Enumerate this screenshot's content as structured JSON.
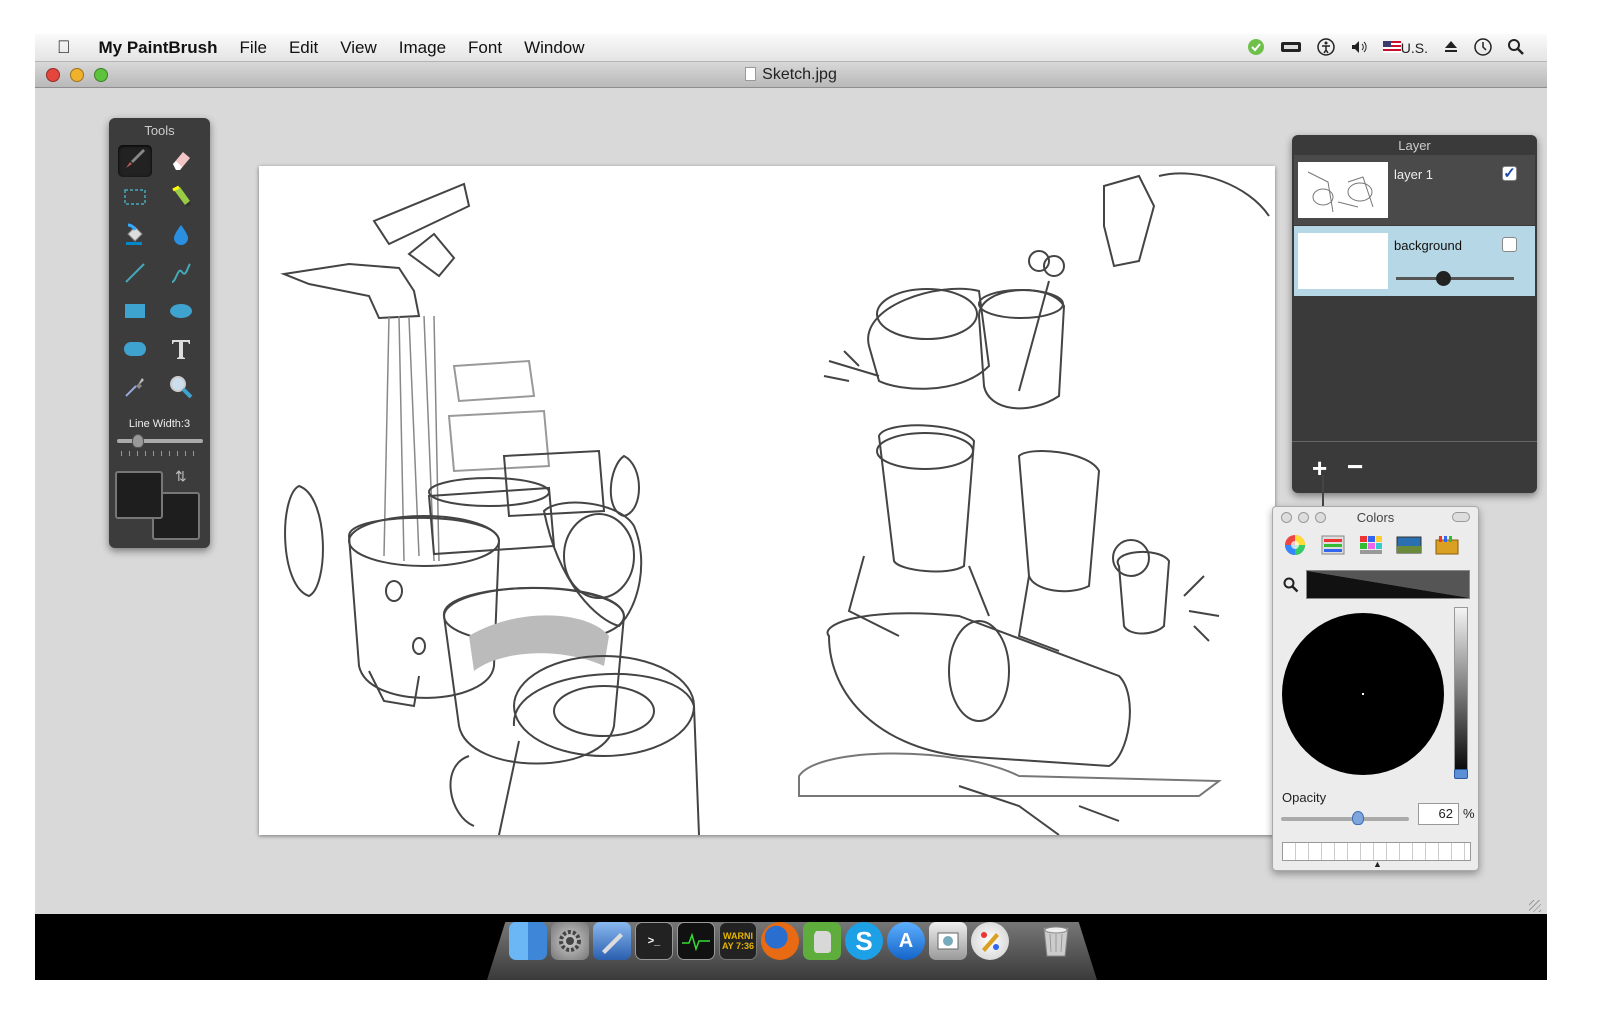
{
  "menubar": {
    "app_name": "My PaintBrush",
    "items": [
      "File",
      "Edit",
      "View",
      "Image",
      "Font",
      "Window"
    ],
    "locale": "U.S."
  },
  "window": {
    "title": "Sketch.jpg"
  },
  "tools": {
    "title": "Tools",
    "line_width_label": "Line Width:3",
    "line_width": 3,
    "selected_tool": "brush"
  },
  "layers": {
    "title": "Layer",
    "items": [
      {
        "name": "layer 1",
        "visible": true
      },
      {
        "name": "background",
        "visible": false,
        "opacity_fraction": 0.42
      }
    ],
    "add_label": "+",
    "remove_label": "−"
  },
  "colors": {
    "title": "Colors",
    "opacity_label": "Opacity",
    "opacity_value": "62",
    "opacity_unit": "%",
    "current_color": "#000000"
  },
  "dock": {
    "console_text_1": "WARNI",
    "console_text_2": "AY 7:36"
  }
}
